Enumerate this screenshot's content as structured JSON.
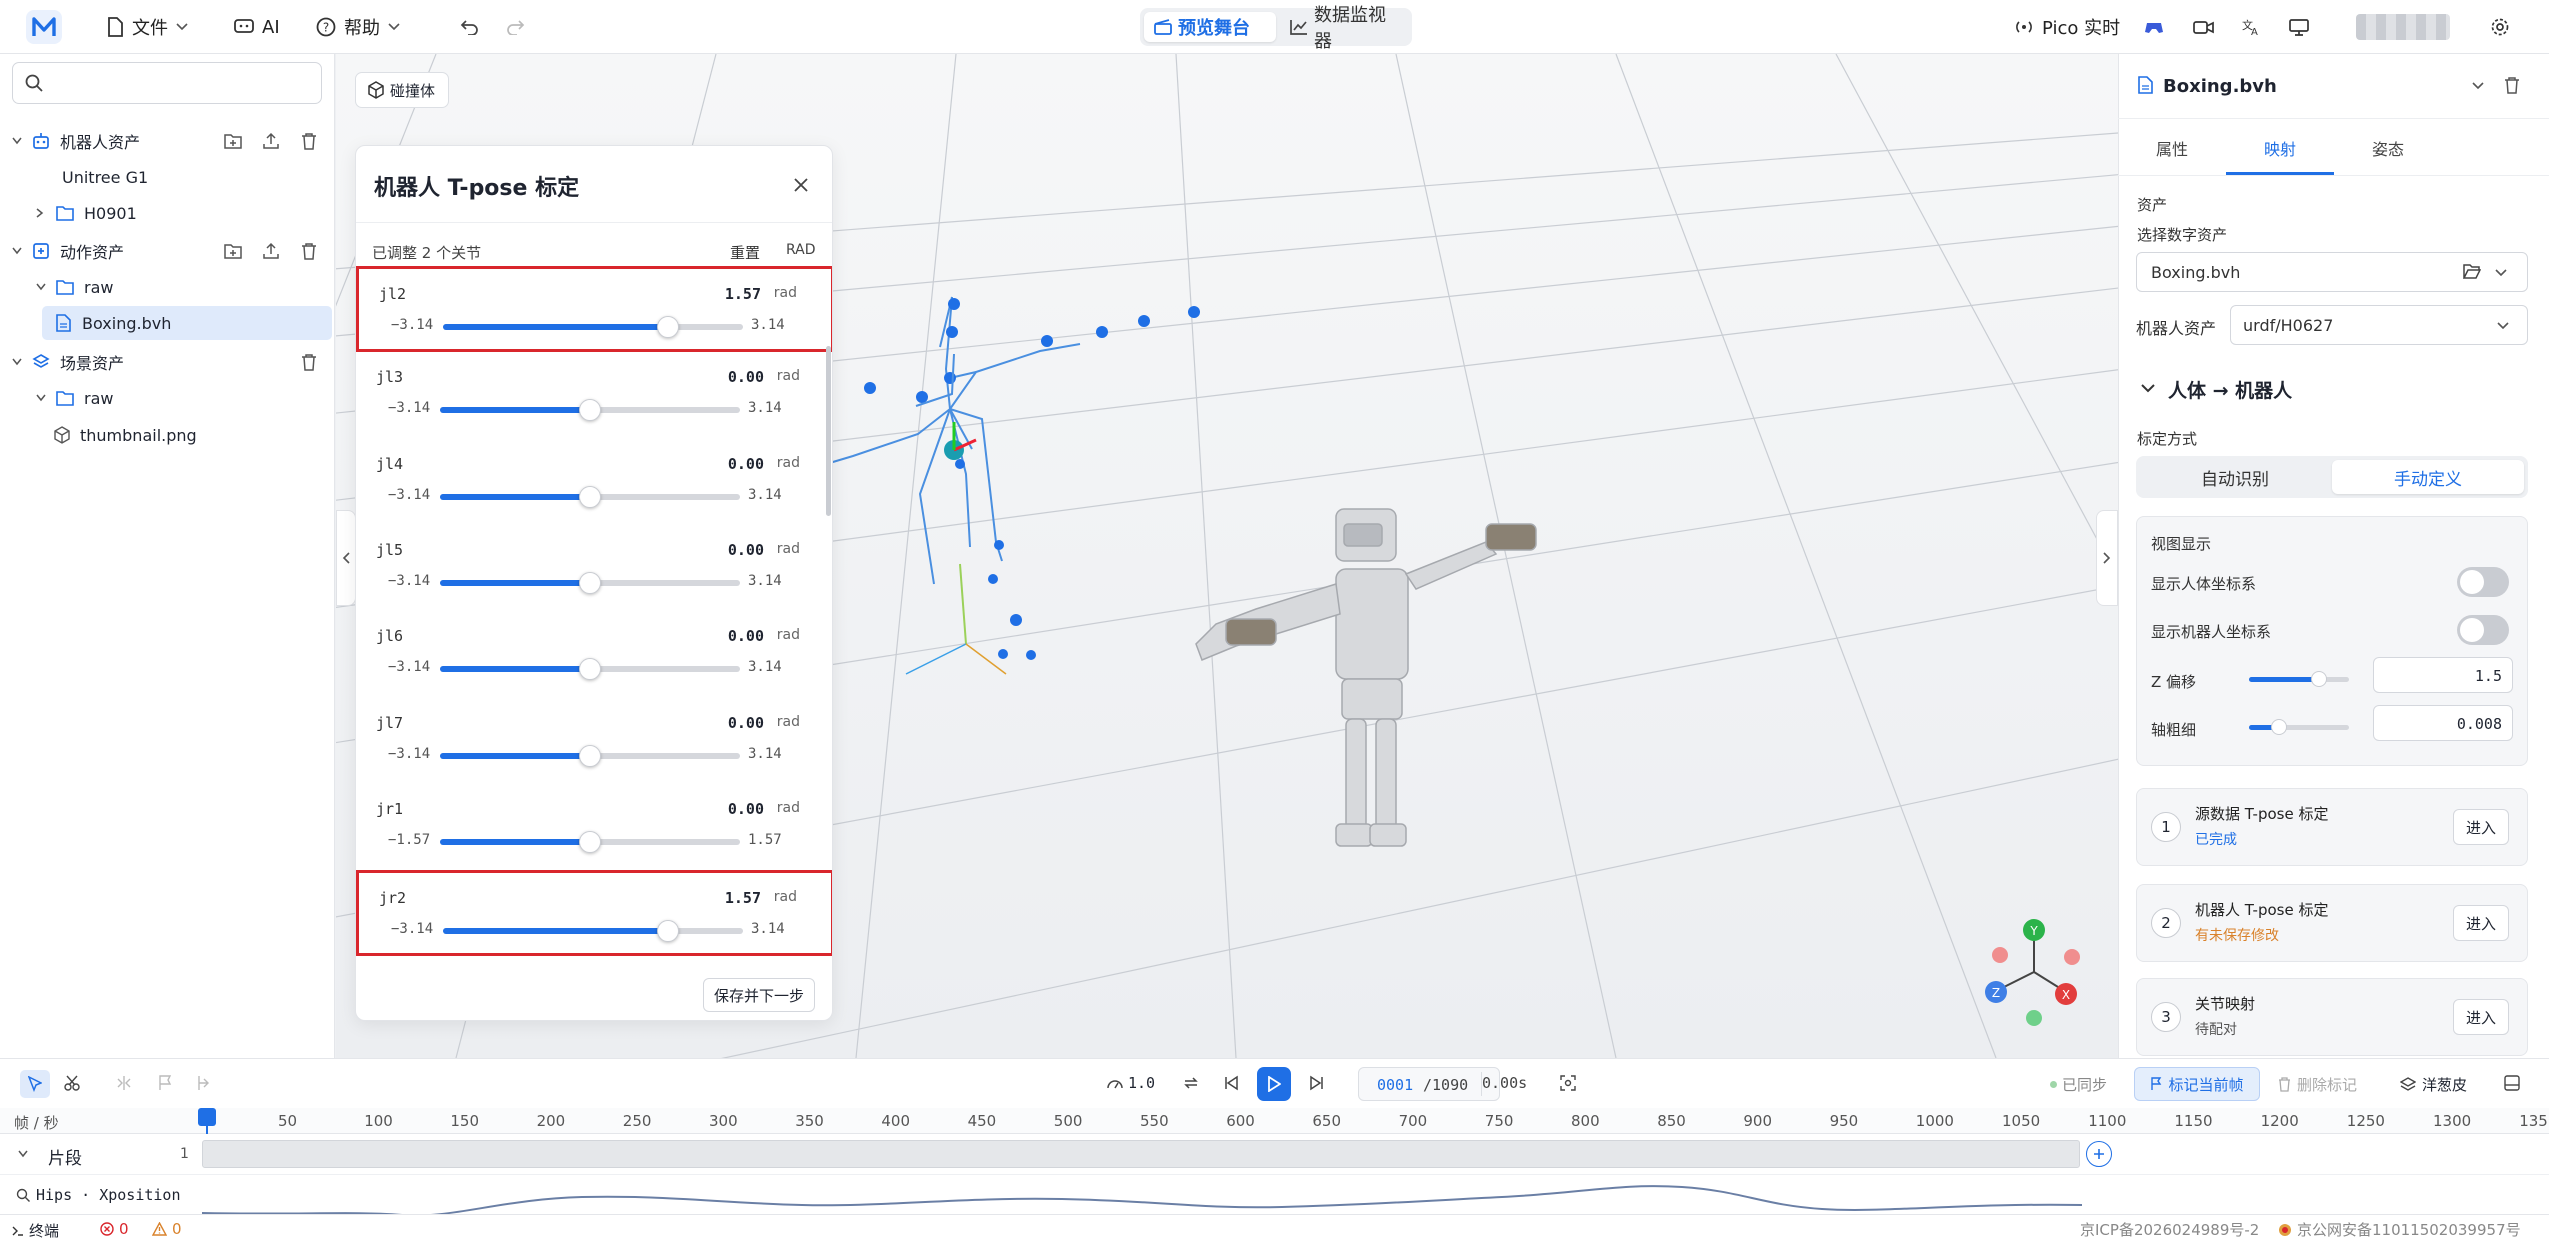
{
  "topbar": {
    "menu_file": "文件",
    "menu_ai": "AI",
    "menu_help": "帮助",
    "tab_preview": "预览舞台",
    "tab_monitor": "数据监视器",
    "pico_label": "Pico 实时"
  },
  "left": {
    "search_placeholder": "",
    "robot_assets": "机器人资产",
    "unitree": "Unitree G1",
    "h0901": "H0901",
    "motion_assets": "动作资产",
    "raw": "raw",
    "boxing": "Boxing.bvh",
    "scene_assets": "场景资产",
    "raw2": "raw",
    "thumbnail": "thumbnail.png"
  },
  "viewport": {
    "collider_label": "碰撞体"
  },
  "dialog": {
    "title": "机器人 T-pose 标定",
    "adjusted": "已调整 2 个关节",
    "reset": "重置",
    "unit_header": "RAD",
    "save_next": "保存并下一步",
    "joints": [
      {
        "name": "jl2",
        "value": "1.57",
        "unit": "rad",
        "min": "−3.14",
        "max": "3.14",
        "fraction": 0.75,
        "highlighted": true
      },
      {
        "name": "jl3",
        "value": "0.00",
        "unit": "rad",
        "min": "−3.14",
        "max": "3.14",
        "fraction": 0.5,
        "highlighted": false
      },
      {
        "name": "jl4",
        "value": "0.00",
        "unit": "rad",
        "min": "−3.14",
        "max": "3.14",
        "fraction": 0.5,
        "highlighted": false
      },
      {
        "name": "jl5",
        "value": "0.00",
        "unit": "rad",
        "min": "−3.14",
        "max": "3.14",
        "fraction": 0.5,
        "highlighted": false
      },
      {
        "name": "jl6",
        "value": "0.00",
        "unit": "rad",
        "min": "−3.14",
        "max": "3.14",
        "fraction": 0.5,
        "highlighted": false
      },
      {
        "name": "jl7",
        "value": "0.00",
        "unit": "rad",
        "min": "−3.14",
        "max": "3.14",
        "fraction": 0.5,
        "highlighted": false
      },
      {
        "name": "jr1",
        "value": "0.00",
        "unit": "rad",
        "min": "−1.57",
        "max": "1.57",
        "fraction": 0.5,
        "highlighted": false
      },
      {
        "name": "jr2",
        "value": "1.57",
        "unit": "rad",
        "min": "−3.14",
        "max": "3.14",
        "fraction": 0.75,
        "highlighted": true
      }
    ]
  },
  "right": {
    "file_title": "Boxing.bvh",
    "tab_props": "属性",
    "tab_mapping": "映射",
    "tab_pose": "姿态",
    "asset_section": "资产",
    "select_digital": "选择数字资产",
    "digital_value": "Boxing.bvh",
    "robot_asset_label": "机器人资产",
    "robot_asset_value": "urdf/H0627",
    "section_title": "人体 → 机器人",
    "calib_method": "标定方式",
    "auto": "自动识别",
    "manual": "手动定义",
    "view_display": "视图显示",
    "show_human_axes": "显示人体坐标系",
    "show_robot_axes": "显示机器人坐标系",
    "z_offset_label": "Z 偏移",
    "z_offset_value": "1.5",
    "z_offset_level": 0.7,
    "axis_thick_label": "轴粗细",
    "axis_thick_value": "0.008",
    "axis_thick_level": 0.3,
    "steps": [
      {
        "num": "1",
        "title": "源数据 T-pose 标定",
        "status": "已完成",
        "status_color": "#1f6fe5",
        "btn": "进入"
      },
      {
        "num": "2",
        "title": "机器人 T-pose 标定",
        "status": "有未保存修改",
        "status_color": "#d9822b",
        "btn": "进入"
      },
      {
        "num": "3",
        "title": "关节映射",
        "status": "待配对",
        "status_color": "#555555",
        "btn": "进入"
      }
    ]
  },
  "controls": {
    "speed": "1.0",
    "frame": "0001",
    "total": "/1090",
    "time": "0.00s",
    "synced": "已同步",
    "mark_frame": "标记当前帧",
    "delete_mark": "删除标记",
    "onion": "洋葱皮"
  },
  "timeline": {
    "fps_label": "帧 / 秒",
    "ticks": [
      "50",
      "100",
      "150",
      "200",
      "250",
      "300",
      "350",
      "400",
      "450",
      "500",
      "550",
      "600",
      "650",
      "700",
      "750",
      "800",
      "850",
      "900",
      "950",
      "1000",
      "1050",
      "1100",
      "1150",
      "1200",
      "1250",
      "1300",
      "135"
    ],
    "segment_label": "片段",
    "segment_count": "1",
    "curve_label": "Hips · Xposition"
  },
  "status": {
    "terminal": "终端",
    "errors": "0",
    "warnings": "0",
    "icp": "京ICP备2026024989号-2",
    "police": "京公网安备11011502039957号"
  },
  "colors": {
    "accent": "#1f6fe5",
    "highlight_border": "#d9262c"
  }
}
